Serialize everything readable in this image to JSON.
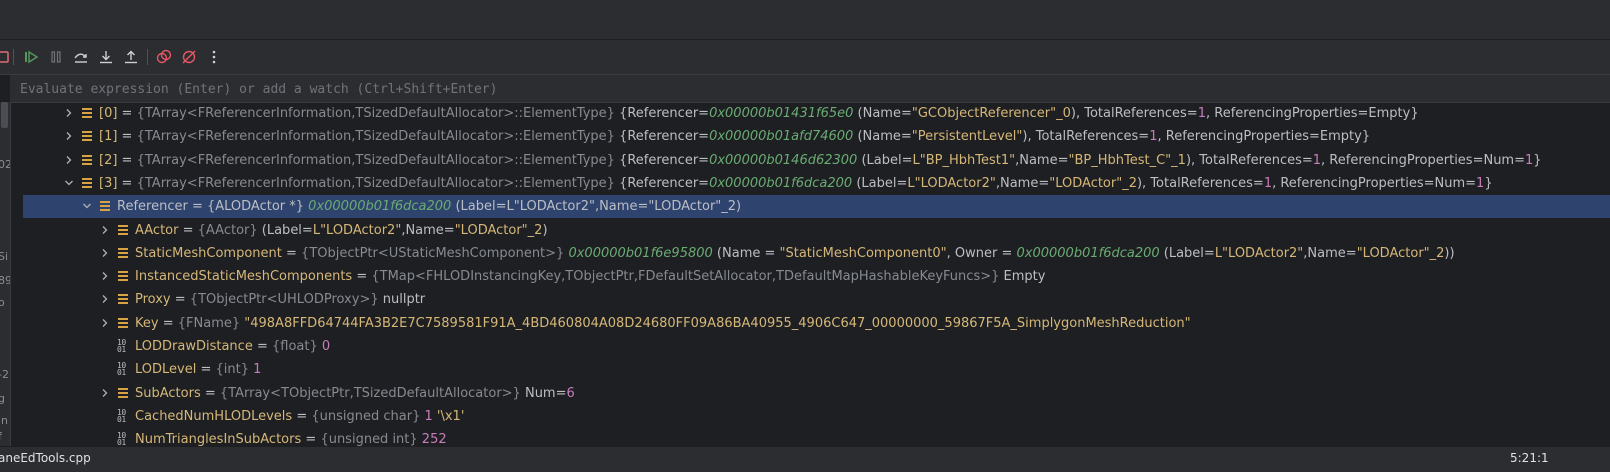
{
  "toolbar": {
    "buttons": [
      {
        "name": "stop-icon",
        "color": "#e06c75"
      },
      {
        "name": "resume-program-icon",
        "color": "#57965c"
      },
      {
        "name": "pause-program-icon",
        "color": "#6f737a"
      },
      {
        "name": "step-over-icon",
        "color": "#ced0d6"
      },
      {
        "name": "step-into-icon",
        "color": "#ced0d6"
      },
      {
        "name": "step-out-icon",
        "color": "#ced0d6"
      },
      {
        "name": "view-breakpoints-icon",
        "color": "#e55765"
      },
      {
        "name": "mute-breakpoints-icon",
        "color": "#e55765"
      },
      {
        "name": "more-options-icon",
        "color": "#ced0d6"
      }
    ]
  },
  "evaluate": {
    "placeholder": "Evaluate expression (Enter) or add a watch (Ctrl+Shift+Enter)"
  },
  "left_clipped_text": [
    "02",
    "Si",
    "89",
    "o",
    "-2",
    "g",
    "in",
    "f"
  ],
  "tree": {
    "rows": [
      {
        "expanded": false,
        "depth": 0,
        "icon": "object",
        "parts": [
          {
            "cls": "idx",
            "t": "[0]"
          },
          {
            "cls": "pl",
            "t": " = "
          },
          {
            "cls": "ty",
            "t": "{TArray<FReferencerInformation,TSizedDefaultAllocator>::ElementType} "
          },
          {
            "cls": "pl",
            "t": "{Referencer="
          },
          {
            "cls": "addr",
            "t": "0x00000b01431f65e0"
          },
          {
            "cls": "pl",
            "t": " (Name="
          },
          {
            "cls": "str",
            "t": "\"GCObjectReferencer\"_0"
          },
          {
            "cls": "pl",
            "t": "), TotalReferences="
          },
          {
            "cls": "numv",
            "t": "1"
          },
          {
            "cls": "pl",
            "t": ", ReferencingProperties=Empty}"
          }
        ]
      },
      {
        "expanded": false,
        "depth": 0,
        "icon": "object",
        "parts": [
          {
            "cls": "idx",
            "t": "[1]"
          },
          {
            "cls": "pl",
            "t": " = "
          },
          {
            "cls": "ty",
            "t": "{TArray<FReferencerInformation,TSizedDefaultAllocator>::ElementType} "
          },
          {
            "cls": "pl",
            "t": "{Referencer="
          },
          {
            "cls": "addr",
            "t": "0x00000b01afd74600"
          },
          {
            "cls": "pl",
            "t": " (Name="
          },
          {
            "cls": "str",
            "t": "\"PersistentLevel\""
          },
          {
            "cls": "pl",
            "t": "), TotalReferences="
          },
          {
            "cls": "numv",
            "t": "1"
          },
          {
            "cls": "pl",
            "t": ", ReferencingProperties=Empty}"
          }
        ]
      },
      {
        "expanded": false,
        "depth": 0,
        "icon": "object",
        "parts": [
          {
            "cls": "idx",
            "t": "[2]"
          },
          {
            "cls": "pl",
            "t": " = "
          },
          {
            "cls": "ty",
            "t": "{TArray<FReferencerInformation,TSizedDefaultAllocator>::ElementType} "
          },
          {
            "cls": "pl",
            "t": "{Referencer="
          },
          {
            "cls": "addr",
            "t": "0x00000b0146d62300"
          },
          {
            "cls": "pl",
            "t": " (Label="
          },
          {
            "cls": "str",
            "t": "L\"BP_HbhTest1\""
          },
          {
            "cls": "pl",
            "t": ",Name="
          },
          {
            "cls": "str",
            "t": "\"BP_HbhTest_C\"_1"
          },
          {
            "cls": "pl",
            "t": "), TotalReferences="
          },
          {
            "cls": "numv",
            "t": "1"
          },
          {
            "cls": "pl",
            "t": ", ReferencingProperties=Num="
          },
          {
            "cls": "numv",
            "t": "1"
          },
          {
            "cls": "pl",
            "t": "}"
          }
        ]
      },
      {
        "expanded": true,
        "depth": 0,
        "icon": "object",
        "parts": [
          {
            "cls": "idx",
            "t": "[3]"
          },
          {
            "cls": "pl",
            "t": " = "
          },
          {
            "cls": "ty",
            "t": "{TArray<FReferencerInformation,TSizedDefaultAllocator>::ElementType} "
          },
          {
            "cls": "pl",
            "t": "{Referencer="
          },
          {
            "cls": "addr",
            "t": "0x00000b01f6dca200"
          },
          {
            "cls": "pl",
            "t": " (Label="
          },
          {
            "cls": "str",
            "t": "L\"LODActor2\""
          },
          {
            "cls": "pl",
            "t": ",Name="
          },
          {
            "cls": "str",
            "t": "\"LODActor\"_2"
          },
          {
            "cls": "pl",
            "t": "), TotalReferences="
          },
          {
            "cls": "numv",
            "t": "1"
          },
          {
            "cls": "pl",
            "t": ", ReferencingProperties=Num="
          },
          {
            "cls": "numv",
            "t": "1"
          },
          {
            "cls": "pl",
            "t": "}"
          }
        ]
      },
      {
        "expanded": true,
        "depth": 1,
        "icon": "object",
        "selected": true,
        "parts": [
          {
            "cls": "pl",
            "t": "Referencer = {ALODActor *} "
          },
          {
            "cls": "addr",
            "t": "0x00000b01f6dca200"
          },
          {
            "cls": "pl",
            "t": " (Label=L\"LODActor2\",Name=\"LODActor\"_2)"
          }
        ]
      },
      {
        "expanded": false,
        "depth": 2,
        "icon": "object",
        "parts": [
          {
            "cls": "nm",
            "t": "AActor"
          },
          {
            "cls": "pl",
            "t": " = "
          },
          {
            "cls": "ty",
            "t": "{AActor} "
          },
          {
            "cls": "pl",
            "t": "(Label="
          },
          {
            "cls": "str",
            "t": "L\"LODActor2\""
          },
          {
            "cls": "pl",
            "t": ",Name="
          },
          {
            "cls": "str",
            "t": "\"LODActor\"_2"
          },
          {
            "cls": "pl",
            "t": ")"
          }
        ]
      },
      {
        "expanded": false,
        "depth": 2,
        "icon": "object",
        "parts": [
          {
            "cls": "nm",
            "t": "StaticMeshComponent"
          },
          {
            "cls": "pl",
            "t": " = "
          },
          {
            "cls": "ty",
            "t": "{TObjectPtr<UStaticMeshComponent>} "
          },
          {
            "cls": "addr",
            "t": "0x00000b01f6e95800"
          },
          {
            "cls": "pl",
            "t": " (Name = "
          },
          {
            "cls": "str",
            "t": "\"StaticMeshComponent0\""
          },
          {
            "cls": "pl",
            "t": ", Owner = "
          },
          {
            "cls": "addr",
            "t": "0x00000b01f6dca200"
          },
          {
            "cls": "pl",
            "t": " (Label="
          },
          {
            "cls": "str",
            "t": "L\"LODActor2\""
          },
          {
            "cls": "pl",
            "t": ",Name="
          },
          {
            "cls": "str",
            "t": "\"LODActor\"_2"
          },
          {
            "cls": "pl",
            "t": "))"
          }
        ]
      },
      {
        "expanded": false,
        "depth": 2,
        "icon": "object",
        "parts": [
          {
            "cls": "nm",
            "t": "InstancedStaticMeshComponents"
          },
          {
            "cls": "pl",
            "t": " = "
          },
          {
            "cls": "ty",
            "t": "{TMap<FHLODInstancingKey,TObjectPtr,FDefaultSetAllocator,TDefaultMapHashableKeyFuncs>} "
          },
          {
            "cls": "pl",
            "t": "Empty"
          }
        ]
      },
      {
        "expanded": false,
        "depth": 2,
        "icon": "object",
        "parts": [
          {
            "cls": "nm",
            "t": "Proxy"
          },
          {
            "cls": "pl",
            "t": " = "
          },
          {
            "cls": "ty",
            "t": "{TObjectPtr<UHLODProxy>} "
          },
          {
            "cls": "pl",
            "t": "nullptr"
          }
        ]
      },
      {
        "expanded": false,
        "depth": 2,
        "icon": "object",
        "parts": [
          {
            "cls": "nm",
            "t": "Key"
          },
          {
            "cls": "pl",
            "t": " = "
          },
          {
            "cls": "ty",
            "t": "{FName} "
          },
          {
            "cls": "str",
            "t": "\"498A8FFD64744FA3B2E7C7589581F91A_4BD460804A08D24680FF09A86BA40955_4906C647_00000000_59867F5A_SimplygonMeshReduction\""
          }
        ]
      },
      {
        "leaf": true,
        "depth": 2,
        "icon": "primitive",
        "parts": [
          {
            "cls": "nm",
            "t": "LODDrawDistance"
          },
          {
            "cls": "pl",
            "t": " = "
          },
          {
            "cls": "ty",
            "t": "{float} "
          },
          {
            "cls": "numv",
            "t": "0"
          }
        ]
      },
      {
        "leaf": true,
        "depth": 2,
        "icon": "primitive",
        "parts": [
          {
            "cls": "nm",
            "t": "LODLevel"
          },
          {
            "cls": "pl",
            "t": " = "
          },
          {
            "cls": "ty",
            "t": "{int} "
          },
          {
            "cls": "numv",
            "t": "1"
          }
        ]
      },
      {
        "expanded": false,
        "depth": 2,
        "icon": "object",
        "parts": [
          {
            "cls": "nm",
            "t": "SubActors"
          },
          {
            "cls": "pl",
            "t": " = "
          },
          {
            "cls": "ty",
            "t": "{TArray<TObjectPtr,TSizedDefaultAllocator>} "
          },
          {
            "cls": "pl",
            "t": "Num="
          },
          {
            "cls": "numv",
            "t": "6"
          }
        ]
      },
      {
        "leaf": true,
        "depth": 2,
        "icon": "primitive",
        "parts": [
          {
            "cls": "nm",
            "t": "CachedNumHLODLevels"
          },
          {
            "cls": "pl",
            "t": " = "
          },
          {
            "cls": "ty",
            "t": "{unsigned char} "
          },
          {
            "cls": "numv",
            "t": "1"
          },
          {
            "cls": "pl",
            "t": " "
          },
          {
            "cls": "str",
            "t": "'\\x1'"
          }
        ]
      },
      {
        "leaf": true,
        "depth": 2,
        "icon": "primitive",
        "parts": [
          {
            "cls": "nm",
            "t": "NumTrianglesInSubActors"
          },
          {
            "cls": "pl",
            "t": " = "
          },
          {
            "cls": "ty",
            "t": "{unsigned int} "
          },
          {
            "cls": "numv",
            "t": "252"
          }
        ]
      }
    ]
  },
  "statusbar": {
    "file": "aneEdTools.cpp",
    "position": "5:21:1"
  }
}
